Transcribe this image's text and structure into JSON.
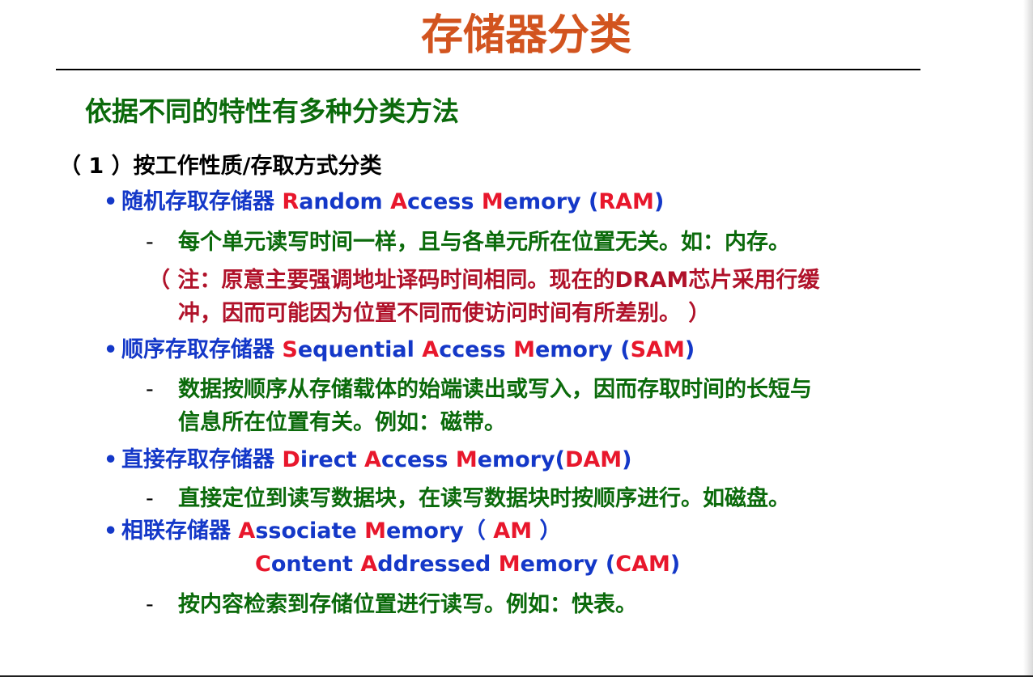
{
  "colors": {
    "title": "#d2541f",
    "green": "#0b6a0b",
    "blue": "#1438c8",
    "red": "#e8172c",
    "note_red": "#b0122a",
    "black": "#000000"
  },
  "title": "存储器分类",
  "subtitle": "依据不同的特性有多种分类方法",
  "section": "（ 1 ）按工作性质/存取方式分类",
  "bullet_symbol": "•",
  "dash_symbol": "-",
  "ram": {
    "cn": "随机存取存储器 ",
    "en": [
      {
        "t": "R",
        "hl": true
      },
      {
        "t": "andom ",
        "hl": false
      },
      {
        "t": "A",
        "hl": true
      },
      {
        "t": "ccess ",
        "hl": false
      },
      {
        "t": "M",
        "hl": true
      },
      {
        "t": "emory (",
        "hl": false
      },
      {
        "t": "RAM",
        "hl": true
      },
      {
        "t": ")",
        "hl": false
      }
    ],
    "desc": "每个单元读写时间一样，且与各单元所在位置无关。如：内存。",
    "note_line1": "（ 注：原意主要强调地址译码时间相同。现在的DRAM芯片采用行缓",
    "note_line2": "冲，因而可能因为位置不同而使访问时间有所差别。 ）"
  },
  "sam": {
    "cn": "顺序存取存储器 ",
    "en": [
      {
        "t": "S",
        "hl": true
      },
      {
        "t": "equential ",
        "hl": false
      },
      {
        "t": "A",
        "hl": true
      },
      {
        "t": "ccess ",
        "hl": false
      },
      {
        "t": "M",
        "hl": true
      },
      {
        "t": "emory (",
        "hl": false
      },
      {
        "t": "SAM",
        "hl": true
      },
      {
        "t": ")",
        "hl": false
      }
    ],
    "desc_line1": "数据按顺序从存储载体的始端读出或写入，因而存取时间的长短与",
    "desc_line2": "信息所在位置有关。例如：磁带。"
  },
  "dam": {
    "cn": "直接存取存储器 ",
    "en": [
      {
        "t": "D",
        "hl": true
      },
      {
        "t": "irect ",
        "hl": false
      },
      {
        "t": "A",
        "hl": true
      },
      {
        "t": "ccess ",
        "hl": false
      },
      {
        "t": "M",
        "hl": true
      },
      {
        "t": "emory(",
        "hl": false
      },
      {
        "t": "DAM",
        "hl": true
      },
      {
        "t": ")",
        "hl": false
      }
    ],
    "desc": "直接定位到读写数据块，在读写数据块时按顺序进行。如磁盘。"
  },
  "am": {
    "cn": "相联存储器 ",
    "en": [
      {
        "t": "A",
        "hl": true
      },
      {
        "t": "ssociate ",
        "hl": false
      },
      {
        "t": "M",
        "hl": true
      },
      {
        "t": "emory（ ",
        "hl": false
      },
      {
        "t": "AM",
        "hl": true
      },
      {
        "t": " ）",
        "hl": false
      }
    ],
    "en2": [
      {
        "t": "C",
        "hl": true
      },
      {
        "t": "ontent ",
        "hl": false
      },
      {
        "t": "A",
        "hl": true
      },
      {
        "t": "ddressed ",
        "hl": false
      },
      {
        "t": "M",
        "hl": true
      },
      {
        "t": "emory (",
        "hl": false
      },
      {
        "t": "CAM",
        "hl": true
      },
      {
        "t": ")",
        "hl": false
      }
    ],
    "desc": "按内容检索到存储位置进行读写。例如：快表。"
  }
}
